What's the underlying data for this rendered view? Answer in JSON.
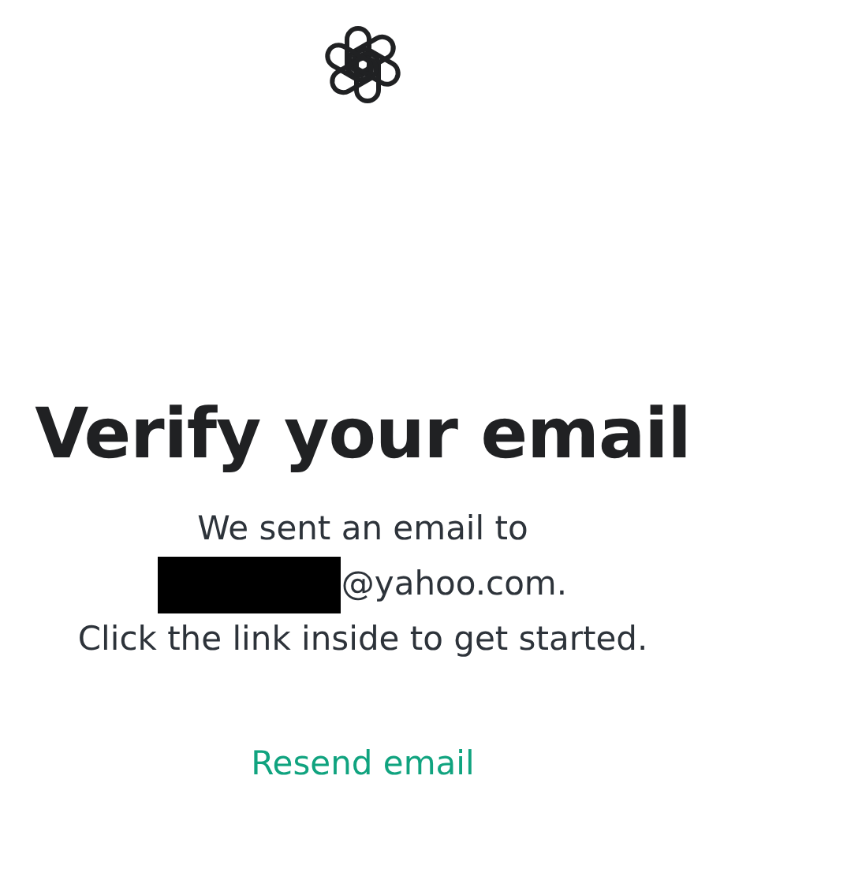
{
  "title": "Verify your email",
  "message": {
    "line_1": "We sent an email to",
    "email": {
      "redacted": true,
      "visible_text": "@yahoo.com."
    },
    "line_3": "Click the link inside to get started."
  },
  "resend_link": "Resend email"
}
